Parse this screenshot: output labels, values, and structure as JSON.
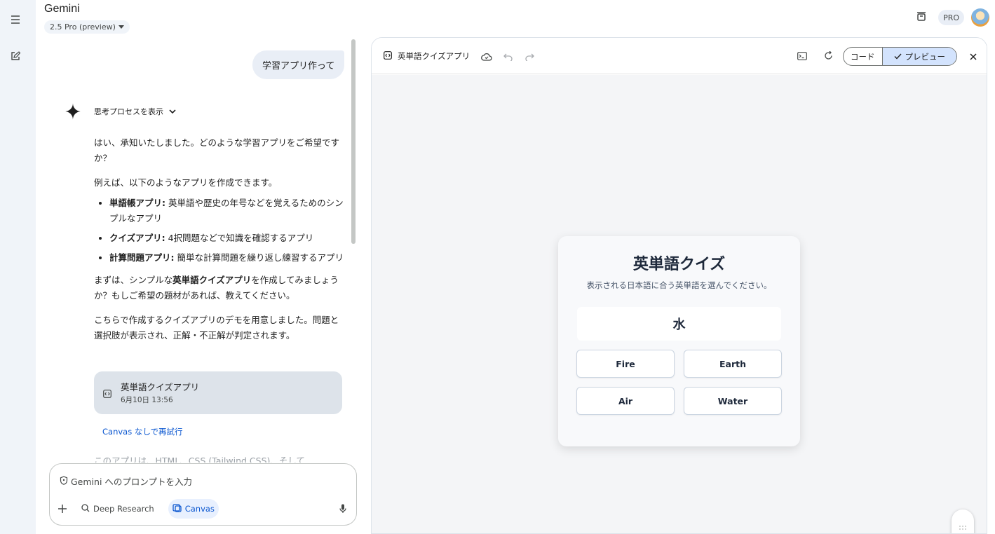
{
  "app": {
    "title": "Gemini",
    "model": "2.5 Pro (preview)",
    "pro_badge": "PRO"
  },
  "chat": {
    "user_message": "学習アプリ作って",
    "thinking_toggle": "思考プロセスを表示",
    "answer": {
      "p1": "はい、承知いたしました。どのような学習アプリをご希望ですか？",
      "p2": "例えば、以下のようなアプリを作成できます。",
      "items": [
        {
          "bold": "単語帳アプリ:",
          "text": " 英単語や歴史の年号などを覚えるためのシンプルなアプリ"
        },
        {
          "bold": "クイズアプリ:",
          "text": " 4択問題などで知識を確認するアプリ"
        },
        {
          "bold": "計算問題アプリ:",
          "text": " 簡単な計算問題を繰り返し練習するアプリ"
        }
      ],
      "p3_pre": "まずは、シンプルな",
      "p3_bold": "英単語クイズアプリ",
      "p3_post": "を作成してみましょうか？もしご希望の題材があれば、教えてください。",
      "p4": "こちらで作成するクイズアプリのデモを用意しました。問題と選択肢が表示され、正解・不正解が判定されます。"
    },
    "canvas_card": {
      "title": "英単語クイズアプリ",
      "date": "6月10日 13:56"
    },
    "retry": "Canvas なしで再試行",
    "faded_text": "このアプリは、HTML、CSS (Tailwind CSS)、そして"
  },
  "prompt": {
    "placeholder": "Gemini へのプロンプトを入力",
    "deep_research": "Deep Research",
    "canvas": "Canvas"
  },
  "panel": {
    "title": "英単語クイズアプリ",
    "code_tab": "コード",
    "preview_tab": "プレビュー"
  },
  "quiz": {
    "title": "英単語クイズ",
    "subtitle": "表示される日本語に合う英単語を選んでください。",
    "word": "水",
    "options": [
      "Fire",
      "Earth",
      "Air",
      "Water"
    ]
  },
  "colors": {
    "accent": "#0b57d0",
    "selected_tab": "#d3e3fd",
    "card_bg": "#dde3ea"
  }
}
